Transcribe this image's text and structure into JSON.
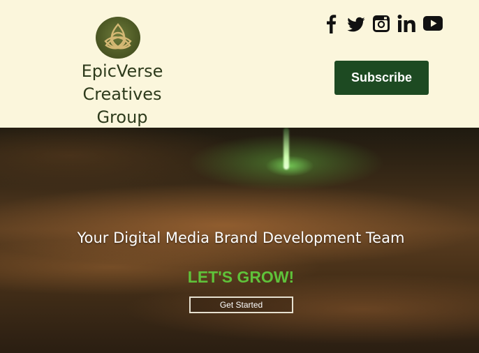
{
  "header": {
    "logo_icon": "trinity-knot-icon",
    "brand_lines": [
      "EpicVerse",
      "Creatives",
      "Group"
    ],
    "social_icons": [
      "facebook-icon",
      "twitter-icon",
      "instagram-icon",
      "linkedin-icon",
      "youtube-icon"
    ],
    "subscribe_label": "Subscribe"
  },
  "hero": {
    "tagline": "Your Digital Media Brand Development Team",
    "headline": "LET'S GROW!",
    "cta_label": "Get Started"
  },
  "colors": {
    "header_bg": "#fbf6dc",
    "brand_text": "#2e3b1c",
    "subscribe_bg": "#1d4a22",
    "headline_green": "#5fc23a"
  }
}
